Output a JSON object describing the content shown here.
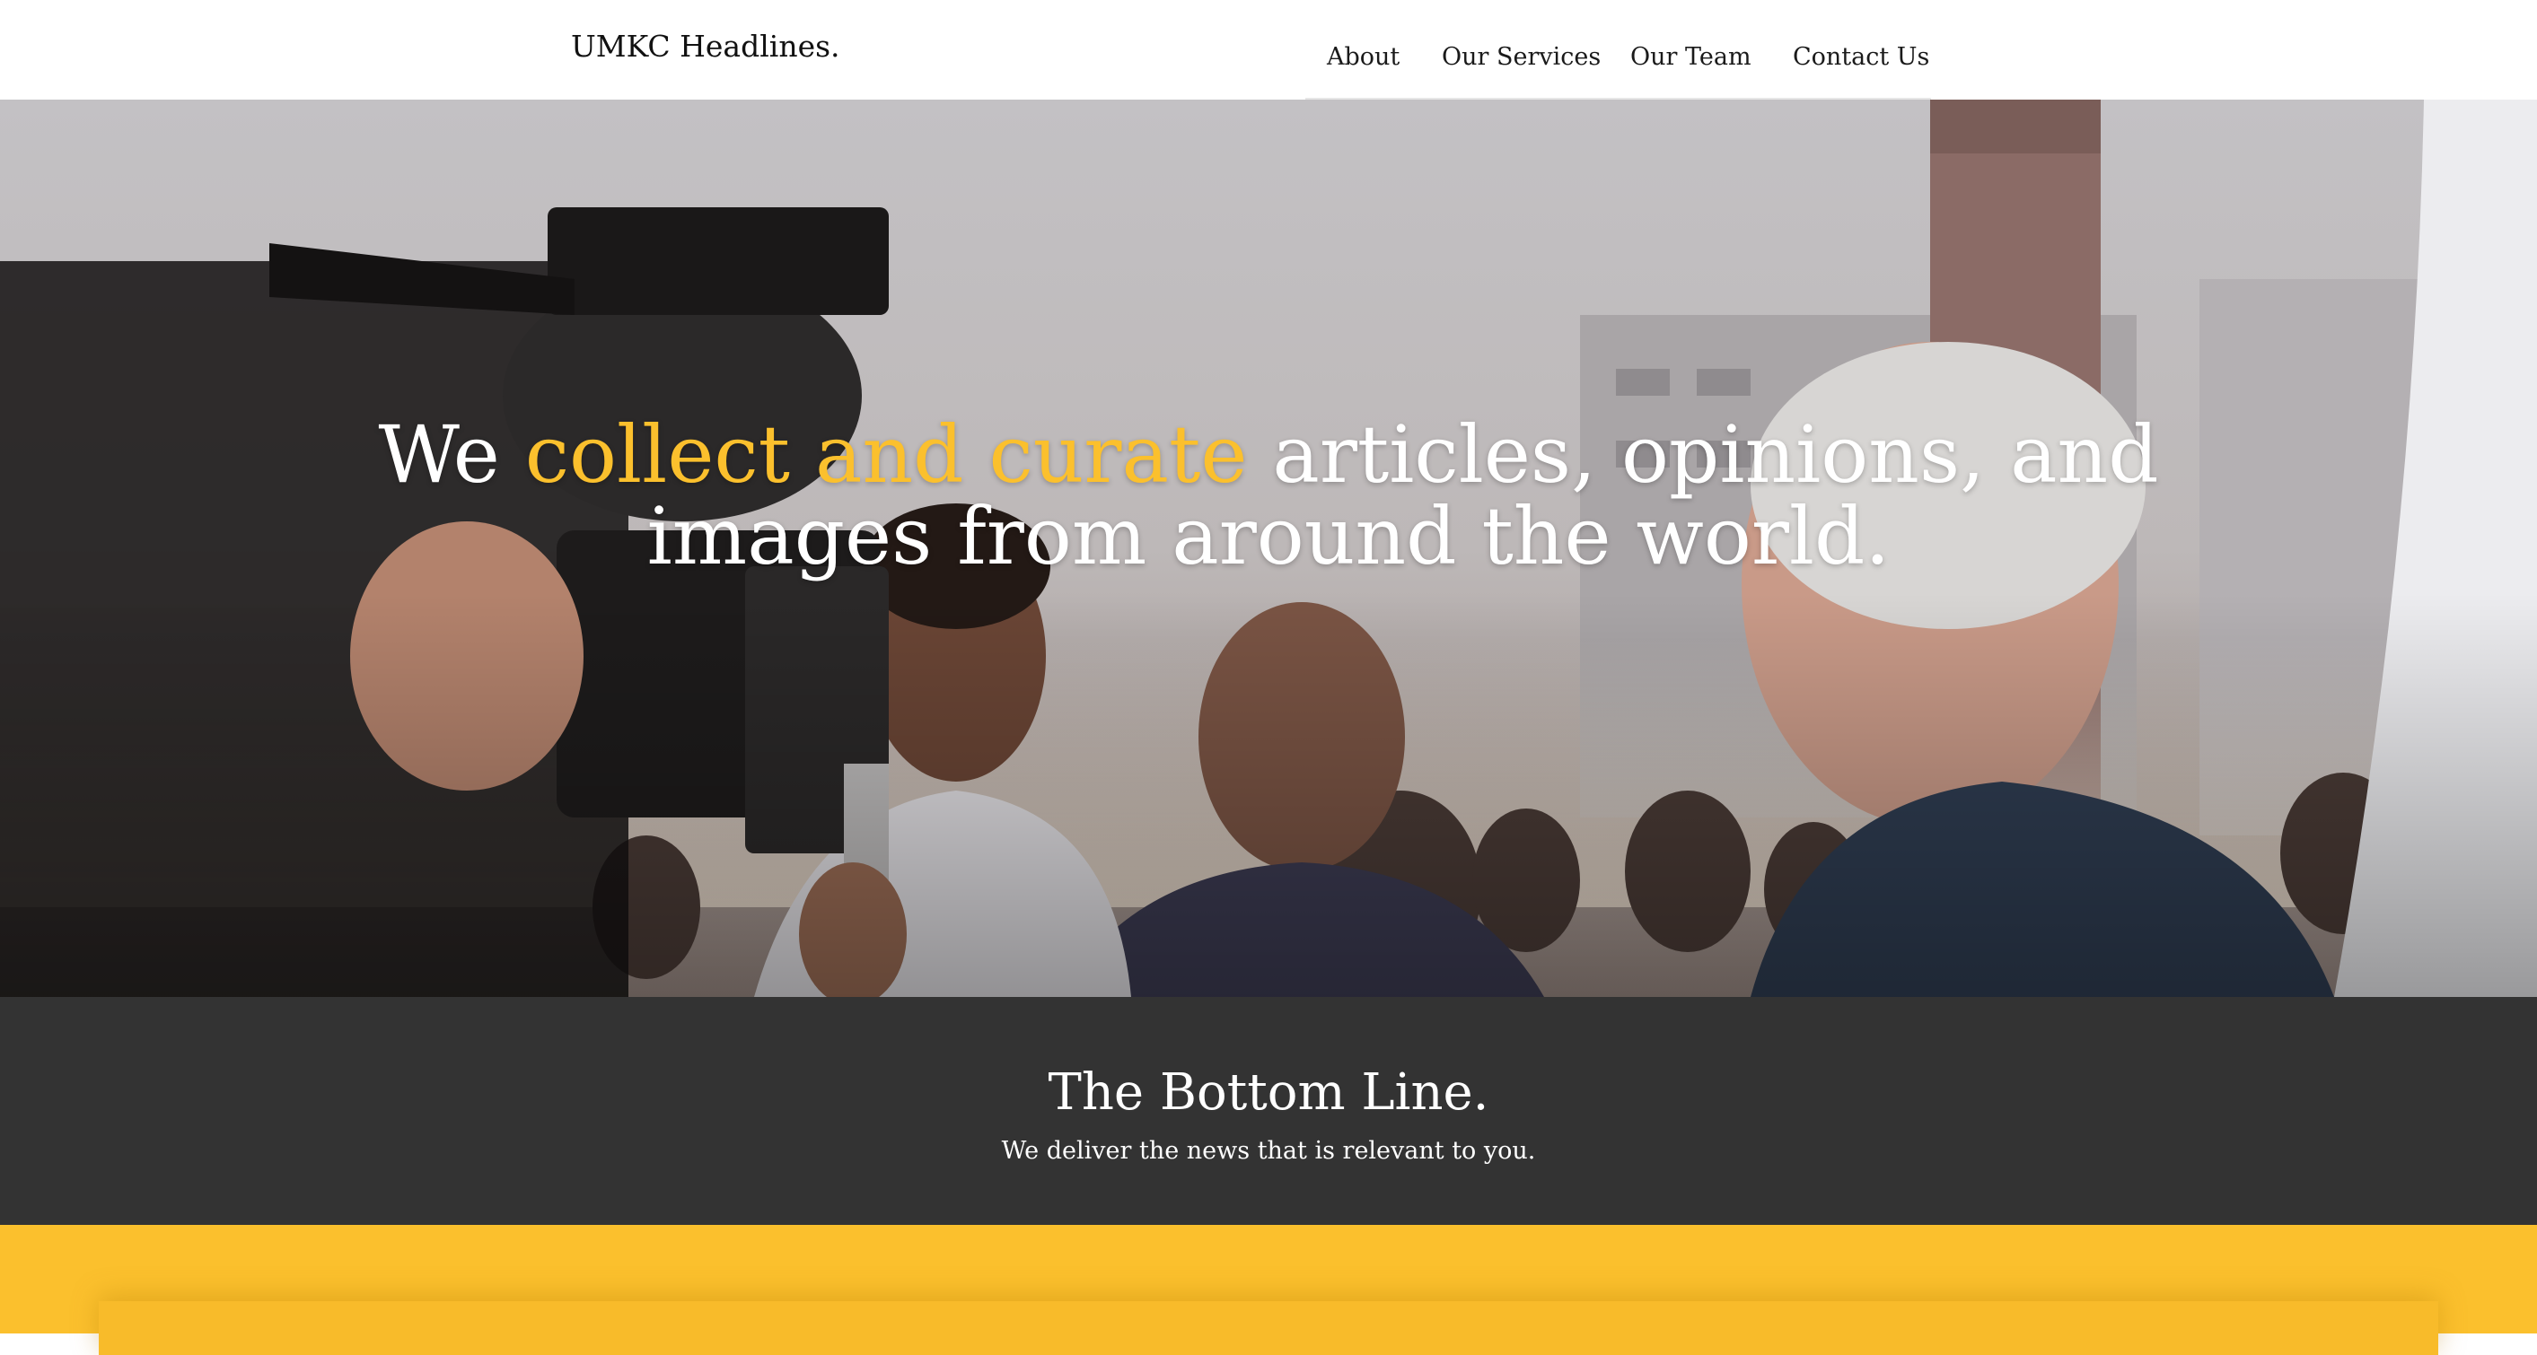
{
  "header": {
    "brand": "UMKC Headlines.",
    "nav": [
      {
        "label": "About"
      },
      {
        "label": "Our Services"
      },
      {
        "label": "Our Team"
      },
      {
        "label": "Contact Us"
      }
    ]
  },
  "hero": {
    "headline_before": "We ",
    "headline_highlight": "collect and curate",
    "headline_after": " articles, opinions, and images from around the world.",
    "highlight_color": "#fbc02d"
  },
  "bottom_line": {
    "title": "The Bottom Line.",
    "subtitle": "We deliver the news that is relevant to you.",
    "background": "#333333"
  },
  "yellow_band": {
    "color": "#fbc02d"
  }
}
